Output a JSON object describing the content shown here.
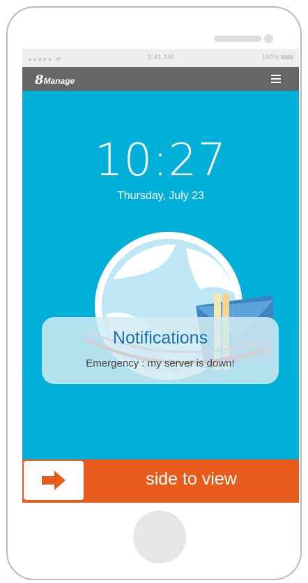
{
  "status_bar": {
    "signal": "●●●●● ᯤ",
    "time": "9:41 AM",
    "battery": "100%"
  },
  "app_bar": {
    "logo_digit": "8",
    "logo_text": "Manage"
  },
  "lock_screen": {
    "clock": "10:27",
    "date": "Thursday, July 23"
  },
  "notification": {
    "title": "Notifications",
    "message": "Emergency : my server is down!"
  },
  "slider": {
    "label": "side to view"
  },
  "colors": {
    "screen_bg": "#00b0d8",
    "app_bar_bg": "#666666",
    "slider_bg": "#e85c1b",
    "notification_title": "#1b6fad"
  }
}
